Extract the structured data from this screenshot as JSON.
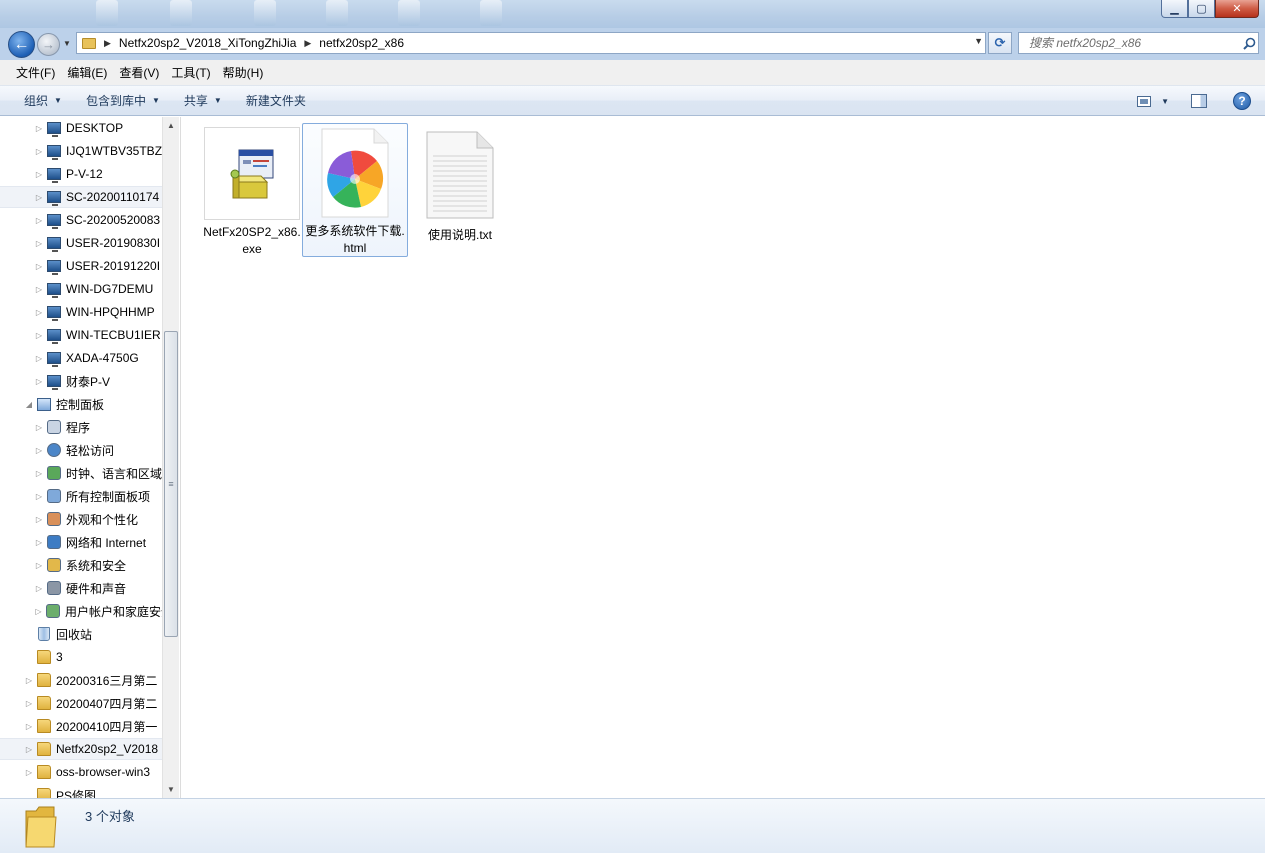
{
  "window": {
    "minimize": "▁",
    "maximize": "▢",
    "close": "✕"
  },
  "address": {
    "breadcrumbs": [
      "Netfx20sp2_V2018_XiTongZhiJia",
      "netfx20sp2_x86"
    ],
    "search_placeholder": "搜索 netfx20sp2_x86"
  },
  "menu": [
    "文件(F)",
    "编辑(E)",
    "查看(V)",
    "工具(T)",
    "帮助(H)"
  ],
  "toolbar": {
    "organize": "组织",
    "include_library": "包含到库中",
    "share": "共享",
    "new_folder": "新建文件夹"
  },
  "nav_tree": [
    {
      "label": "DESKTOP",
      "icon": "computer-icon"
    },
    {
      "label": "IJQ1WTBV35TBZ",
      "icon": "computer-icon"
    },
    {
      "label": "P-V-12",
      "icon": "computer-icon"
    },
    {
      "label": "SC-20200110174",
      "icon": "computer-icon"
    },
    {
      "label": "SC-20200520083",
      "icon": "computer-icon"
    },
    {
      "label": "USER-20190830I",
      "icon": "computer-icon"
    },
    {
      "label": "USER-20191220I",
      "icon": "computer-icon"
    },
    {
      "label": "WIN-DG7DEMU",
      "icon": "computer-icon"
    },
    {
      "label": "WIN-HPQHHMP",
      "icon": "computer-icon"
    },
    {
      "label": "WIN-TECBU1IER",
      "icon": "computer-icon"
    },
    {
      "label": "XADA-4750G",
      "icon": "computer-icon"
    },
    {
      "label": "财泰P-V",
      "icon": "computer-icon"
    },
    {
      "label": "控制面板",
      "icon": "control-panel-icon"
    },
    {
      "label": "程序",
      "icon": "programs-icon"
    },
    {
      "label": "轻松访问",
      "icon": "ease-of-access-icon"
    },
    {
      "label": "时钟、语言和区域",
      "icon": "clock-language-icon"
    },
    {
      "label": "所有控制面板项",
      "icon": "control-panel-items-icon"
    },
    {
      "label": "外观和个性化",
      "icon": "appearance-icon"
    },
    {
      "label": "网络和 Internet",
      "icon": "network-icon"
    },
    {
      "label": "系统和安全",
      "icon": "system-security-icon"
    },
    {
      "label": "硬件和声音",
      "icon": "hardware-sound-icon"
    },
    {
      "label": "用户帐户和家庭安全",
      "icon": "user-accounts-icon"
    },
    {
      "label": "回收站",
      "icon": "recycle-bin-icon"
    },
    {
      "label": "3",
      "icon": "folder-icon"
    },
    {
      "label": "20200316三月第二",
      "icon": "folder-icon"
    },
    {
      "label": "20200407四月第二",
      "icon": "folder-icon"
    },
    {
      "label": "20200410四月第一",
      "icon": "folder-icon"
    },
    {
      "label": "Netfx20sp2_V2018",
      "icon": "folder-icon"
    },
    {
      "label": "oss-browser-win3",
      "icon": "folder-icon"
    },
    {
      "label": "PS修图",
      "icon": "folder-icon"
    }
  ],
  "files": [
    {
      "name": "NetFx20SP2_x86.exe",
      "icon": "installer-icon"
    },
    {
      "name": "更多系统软件下载.html",
      "icon": "browser-pinwheel-icon"
    },
    {
      "name": "使用说明.txt",
      "icon": "text-file-icon"
    }
  ],
  "status": {
    "count": "3 个对象"
  }
}
